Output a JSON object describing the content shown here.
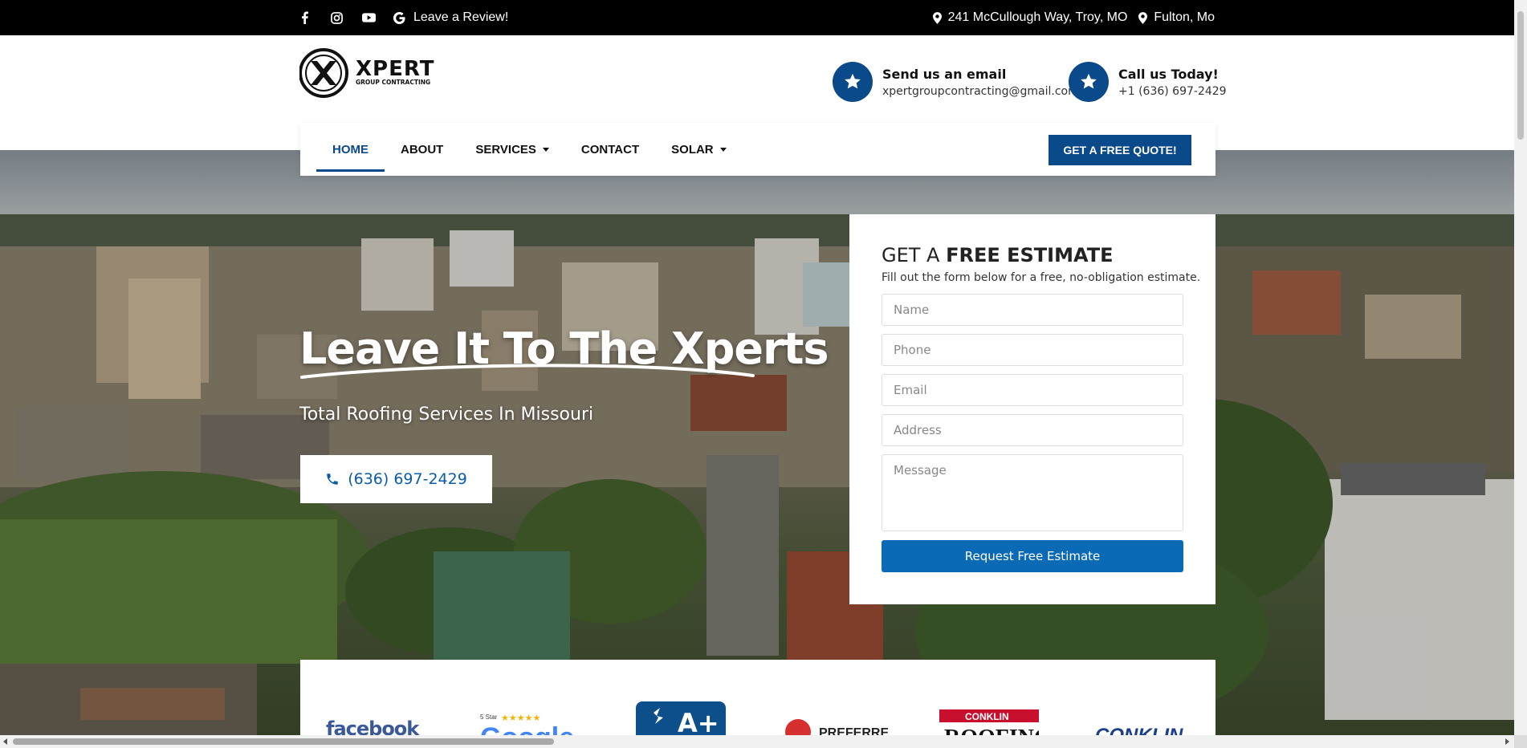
{
  "topbar": {
    "review_label": "Leave a Review!",
    "address": "241 McCullough Way, Troy, MO",
    "city": "Fulton, Mo"
  },
  "header": {
    "logo_text": "XPERT",
    "logo_sub": "GROUP CONTRACTING",
    "email_title": "Send us an email",
    "email_value": "xpertgroupcontracting@gmail.com",
    "call_title": "Call us Today!",
    "call_value": "+1 (636) 697-2429"
  },
  "nav": {
    "items": [
      {
        "label": "HOME",
        "dropdown": false,
        "active": true
      },
      {
        "label": "ABOUT",
        "dropdown": false,
        "active": false
      },
      {
        "label": "SERVICES",
        "dropdown": true,
        "active": false
      },
      {
        "label": "CONTACT",
        "dropdown": false,
        "active": false
      },
      {
        "label": "SOLAR",
        "dropdown": true,
        "active": false
      }
    ],
    "cta": "GET A FREE QUOTE!"
  },
  "hero": {
    "headline": "Leave It To The Xperts",
    "subheadline": "Total Roofing Services In Missouri",
    "phone_button": "(636) 697-2429"
  },
  "estimate_form": {
    "title_prefix": "GET A ",
    "title_bold": "FREE ESTIMATE",
    "description": "Fill out the form below for a free, no-obligation estimate.",
    "fields": [
      "Name",
      "Phone",
      "Email",
      "Address"
    ],
    "message_placeholder": "Message",
    "submit": "Request Free Estimate"
  },
  "logos": {
    "facebook": "facebook",
    "google_top": "5 Star",
    "google": "Google",
    "bbb": "A+",
    "preferred": "PREFERRED",
    "conklin_badge": "CONKLIN",
    "conklin_roofing": "ROOFING",
    "conklin2": "CONKLIN"
  },
  "colors": {
    "brand_blue": "#0b4a8a",
    "button_blue": "#0b6ab6",
    "topbar_bg": "#000000"
  }
}
